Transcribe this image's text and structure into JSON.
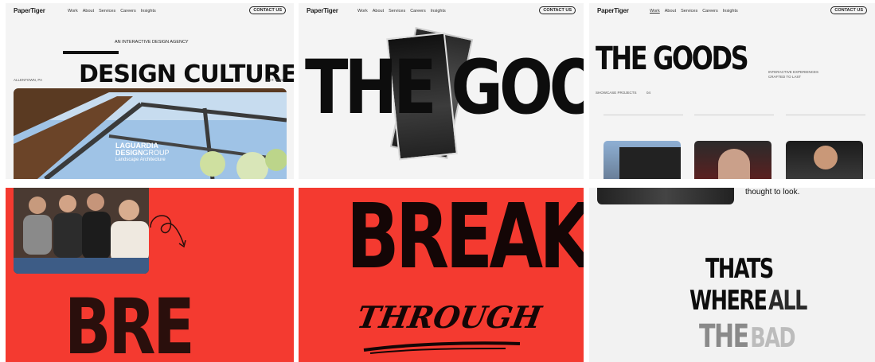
{
  "nav": {
    "logo": "PaperTiger",
    "links": [
      "Work",
      "About",
      "Services",
      "Careers",
      "Insights"
    ],
    "cta": "CONTACT US"
  },
  "tile1": {
    "tagline": "AN INTERACTIVE DESIGN AGENCY",
    "headline": "DESIGN CULTURE",
    "left_meta": "ALLENTOWN, PA",
    "right_meta": "EST. 2009",
    "photo_caption_line1": "LAGUARDIA",
    "photo_caption_line2": "DESIGN",
    "photo_caption_line2b": "GROUP",
    "photo_caption_line3": "Landscape Architecture"
  },
  "tile2": {
    "headline": "THE GOODS"
  },
  "tile3": {
    "headline": "THE GOODS",
    "meta_line1": "INTERACTIVE EXPERIENCES",
    "meta_line2": "CRAFTED TO LAST",
    "filter_left": "SHOWCASE PROJECTS",
    "filter_count": "04"
  },
  "tile4": {
    "headline": "BRE"
  },
  "tile5": {
    "headline": "BREAK",
    "script": "THROUGH"
  },
  "tile6": {
    "caption": "thought to look.",
    "line1": "THATS",
    "line2a": "WHERE",
    "line2b": "ALL",
    "line3a": "THE",
    "line3b": "BAD"
  },
  "colors": {
    "red": "#f43a30",
    "ink": "#0d0d0d",
    "paper": "#f4f4f4"
  }
}
